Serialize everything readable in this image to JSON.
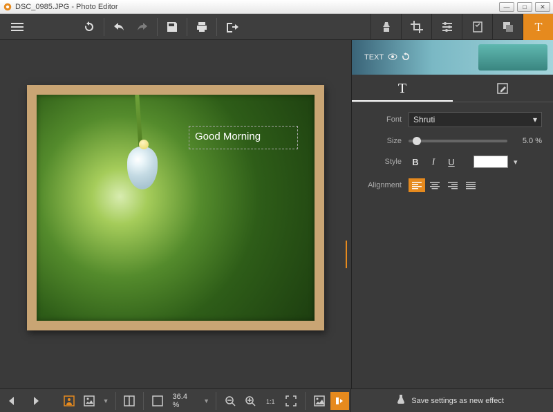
{
  "window": {
    "title": "DSC_0985.JPG - Photo Editor"
  },
  "canvas": {
    "text_overlay": "Good  Morning"
  },
  "text_panel": {
    "banner_label": "TEXT",
    "font_label": "Font",
    "font_value": "Shruti",
    "size_label": "Size",
    "size_value": "5.0 %",
    "style_label": "Style",
    "style_bold": "B",
    "style_italic": "I",
    "style_underline": "U",
    "color": "#ffffff",
    "alignment_label": "Alignment"
  },
  "bottombar": {
    "zoom_value": "36.4 %",
    "save_effect_label": "Save settings as new effect"
  }
}
